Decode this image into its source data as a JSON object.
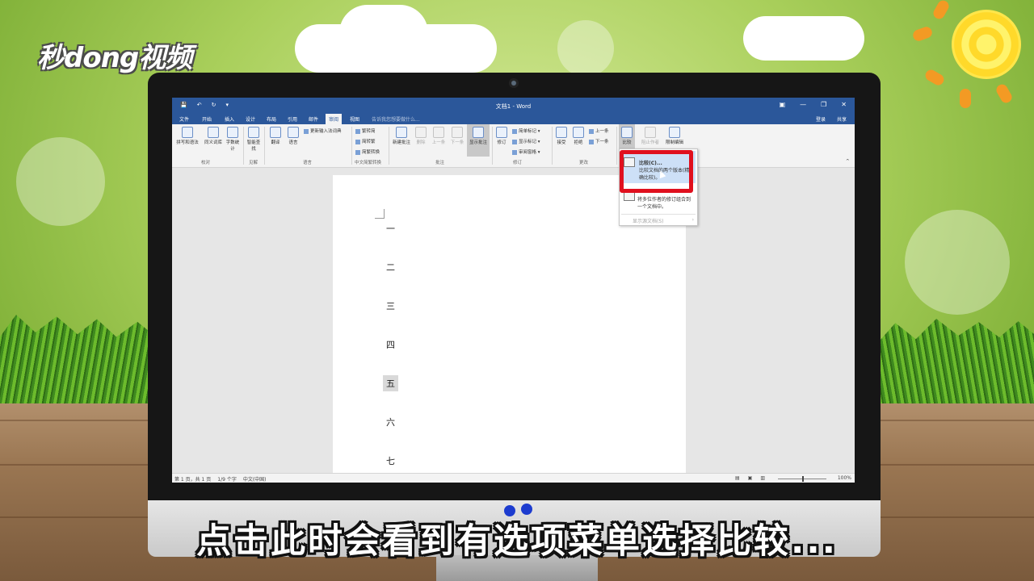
{
  "branding": {
    "logo": "秒dong视频"
  },
  "word": {
    "doc_title": "文档1 - Word",
    "qat": [
      "💾",
      "↶",
      "↻",
      "▾"
    ],
    "window_buttons": [
      "▣",
      "—",
      "❐",
      "✕"
    ],
    "tabs": [
      "文件",
      "开始",
      "插入",
      "设计",
      "布局",
      "引用",
      "邮件",
      "审阅",
      "视图"
    ],
    "active_tab": "审阅",
    "tell_me": "告诉我您想要做什么...",
    "login": "登录",
    "share": "共享"
  },
  "ribbon": {
    "groups": [
      "校对",
      "见解",
      "语言",
      "中文简繁转换",
      "批注",
      "修订",
      "更改"
    ],
    "spelling": "拼写和语法",
    "thesaurus": "同义词库",
    "wordcount": "字数统计",
    "smart_lookup": "智能查找",
    "translate": "翻译",
    "language": "语言",
    "update_ime": "更新输入法词典",
    "trad_to_simp": "繁转简",
    "simp_to_trad": "简转繁",
    "convert": "简繁转换",
    "new_comment": "新建批注",
    "delete": "删除",
    "prev": "上一条",
    "next": "下一条",
    "show_comments": "显示批注",
    "track": "修订",
    "simple_markup": "简单标记",
    "show_markup": "显示标记",
    "review_pane": "审阅窗格",
    "accept": "接受",
    "reject": "拒绝",
    "prev_change": "上一条",
    "next_change": "下一条",
    "compare": "比较",
    "block_authors": "阻止作者",
    "restrict_edit": "限制编辑",
    "collapse": "^"
  },
  "document": {
    "lines": [
      "一",
      "二",
      "三",
      "四",
      "五",
      "六",
      "七"
    ],
    "highlighted_index": 4
  },
  "statusbar": {
    "page": "第 1 页，共 1 页",
    "words": "1/9 个字",
    "lang": "中文(中国)",
    "zoom": "100%"
  },
  "dropdown": {
    "compare_title": "比较(C)...",
    "compare_desc": "比较文档的两个版本(精确比较)。",
    "combine_desc": "将多位作者的修订组合到一个文档中。",
    "show_source": "显示源文档(S)",
    "arrow": "›"
  },
  "caption": {
    "subtitle": "点击此时会看到有选项菜单选择比较..."
  }
}
